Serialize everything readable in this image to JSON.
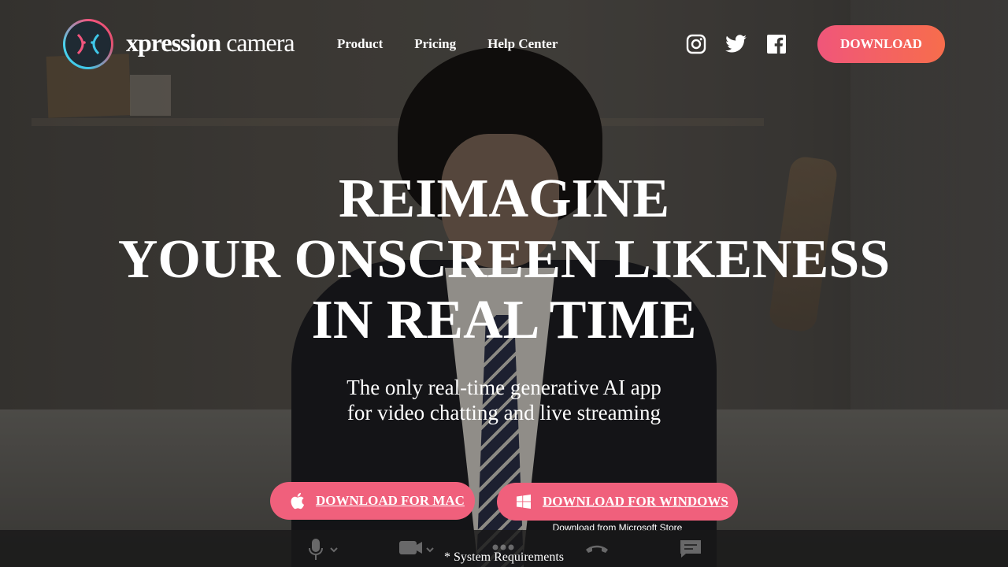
{
  "brand": {
    "name_bold": "xpression",
    "name_light": " camera"
  },
  "nav": [
    {
      "label": "Product"
    },
    {
      "label": "Pricing"
    },
    {
      "label": "Help Center"
    }
  ],
  "social": [
    "instagram-icon",
    "twitter-icon",
    "facebook-icon"
  ],
  "header": {
    "download_label": "DOWNLOAD"
  },
  "hero": {
    "title_lines": [
      "REIMAGINE",
      "YOUR ONSCREEN LIKENESS",
      "IN REAL TIME"
    ],
    "subtitle_lines": [
      "The only real-time generative AI app",
      "for video chatting and live streaming"
    ]
  },
  "cta": {
    "mac_label": "DOWNLOAD FOR MAC",
    "windows_label": "DOWNLOAD FOR WINDOWS",
    "ms_store_note": "Download from Microsoft Store",
    "system_requirements": "* System Requirements"
  },
  "callbar_icons": [
    "microphone-icon",
    "camera-icon",
    "more-icon",
    "hang-up-icon",
    "chat-icon"
  ],
  "colors": {
    "accent": "#f0607c",
    "accent_end": "#f76d4c",
    "logo_teal": "#3fc7e8"
  }
}
